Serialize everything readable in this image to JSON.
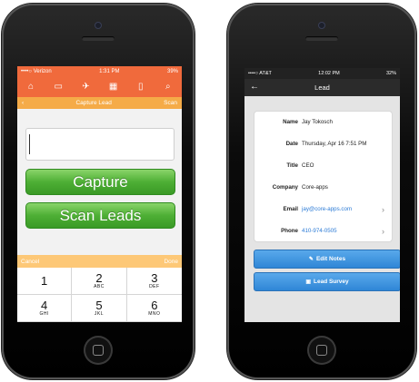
{
  "left_phone": {
    "status": {
      "carrier": "••••○ Verizon",
      "time": "1:31 PM",
      "battery": "39%"
    },
    "nav_icons": [
      "home-icon",
      "bus-icon",
      "plane-icon",
      "grid-icon",
      "phone-icon",
      "search-icon"
    ],
    "nav_glyphs": [
      "⌂",
      "▭",
      "✈",
      "▦",
      "▯",
      "⌕"
    ],
    "subbar": {
      "back": "‹",
      "title": "Capture Lead",
      "action": "Scan"
    },
    "input": {
      "value": "",
      "placeholder": ""
    },
    "buttons": {
      "capture": "Capture",
      "scan_leads": "Scan Leads"
    },
    "keyboard_bar": {
      "cancel": "Cancel",
      "done": "Done"
    },
    "keypad": [
      {
        "digit": "1",
        "letters": ""
      },
      {
        "digit": "2",
        "letters": "ABC"
      },
      {
        "digit": "3",
        "letters": "DEF"
      },
      {
        "digit": "4",
        "letters": "GHI"
      },
      {
        "digit": "5",
        "letters": "JKL"
      },
      {
        "digit": "6",
        "letters": "MNO"
      }
    ],
    "colors": {
      "header": "#f06a3c",
      "subbar": "#f5ab48",
      "button_green": "#4eaf35"
    }
  },
  "right_phone": {
    "status": {
      "carrier": "••••○ AT&T",
      "time": "12:02 PM",
      "battery": "32%"
    },
    "navbar": {
      "back": "←",
      "title": "Lead"
    },
    "fields": [
      {
        "label": "Name",
        "value": "Jay Tokosch",
        "link": false
      },
      {
        "label": "Date",
        "value": "Thursday, Apr 16 7:51 PM",
        "link": false
      },
      {
        "label": "Title",
        "value": "CEO",
        "link": false
      },
      {
        "label": "Company",
        "value": "Core-apps",
        "link": false
      },
      {
        "label": "Email",
        "value": "jay@core-apps.com",
        "link": true
      },
      {
        "label": "Phone",
        "value": "410-974-0505",
        "link": true
      }
    ],
    "buttons": {
      "edit_notes": "Edit Notes",
      "lead_survey": "Lead Survey"
    },
    "colors": {
      "link": "#2c7bd6",
      "button_blue": "#2f86d6"
    }
  }
}
